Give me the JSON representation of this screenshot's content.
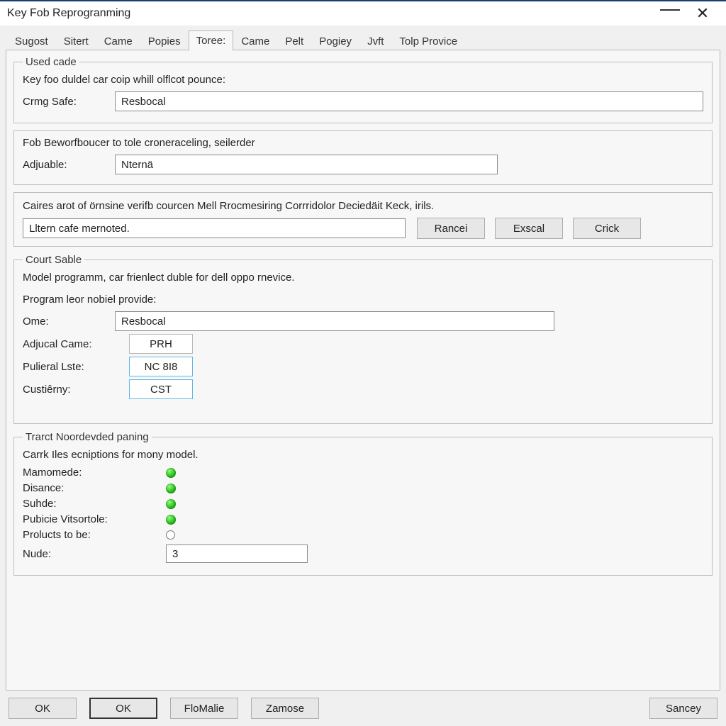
{
  "window": {
    "title": "Key Fob Reprogranming"
  },
  "tabs": [
    "Sugost",
    "Sitert",
    "Came",
    "Popies",
    "Toree:",
    "Came",
    "Pelt",
    "Pogiey",
    "Jvft",
    "Tolp Provice"
  ],
  "active_tab_index": 4,
  "group1": {
    "legend": "Used cade",
    "desc": "Key foo duldel car coip whill olflcot pounce:",
    "field_label": "Crmg Safe:",
    "field_value": "Resbocal"
  },
  "group2": {
    "desc": "Fob Beworfboucer to tole croneraceling, seilerder",
    "field_label": "Adjuable:",
    "field_value": "Nternä"
  },
  "group3": {
    "desc": "Caires arot of örnsine verifb courcen Mell Rrocmesiring Corrridolor Deciedäit Keck, irils.",
    "input_value": "Lltern cafe mernoted.",
    "buttons": [
      "Rancei",
      "Exscal",
      "Crick"
    ]
  },
  "group4": {
    "legend": "Court Sable",
    "desc": "Model programm, car frienlect duble for dell oppo rnevice.",
    "sub1": "Program leor nobiel provide:",
    "ome_label": "Ome:",
    "ome_value": "Resbocal",
    "rows": [
      {
        "label": "Adjucal Came:",
        "value": "PRH"
      },
      {
        "label": "Pulieral Lste:",
        "value": "NC 8I8"
      },
      {
        "label": "Custiêrny:",
        "value": "CST"
      }
    ]
  },
  "group5": {
    "legend": "Trarct Noordevded paning",
    "desc": "Carrk Iles ecniptions for mony model.",
    "statuses": [
      {
        "label": "Mamomede:",
        "on": true
      },
      {
        "label": "Disance:",
        "on": true
      },
      {
        "label": "Suhde:",
        "on": true
      },
      {
        "label": "Pubicie Vitsortole:",
        "on": true
      },
      {
        "label": "Prolucts to be:",
        "on": false
      }
    ],
    "nude_label": "Nude:",
    "nude_value": "3"
  },
  "footer": {
    "buttons_left": [
      "OK",
      "OK",
      "FloMalie",
      "Zamose"
    ],
    "default_index": 1,
    "button_right": "Sancey"
  }
}
